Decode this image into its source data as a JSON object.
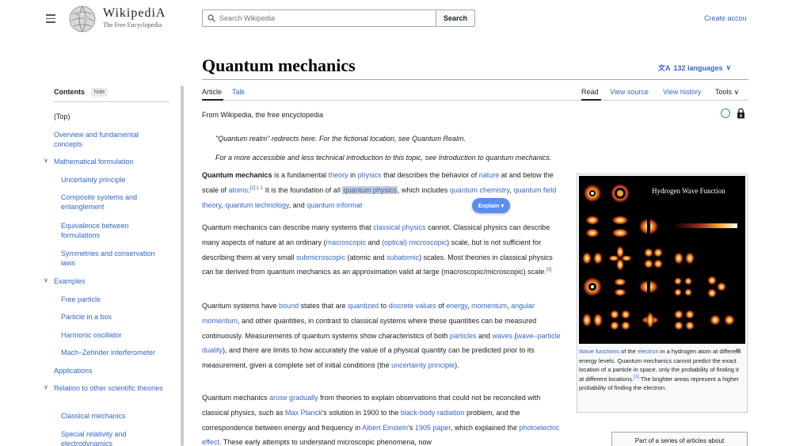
{
  "header": {
    "logo_word": "WikipediA",
    "logo_tagline": "The Free Encyclopedia",
    "search_placeholder": "Search Wikipedia",
    "search_button": "Search",
    "create_account": "Create accou"
  },
  "toc": {
    "title": "Contents",
    "hide": "hide",
    "items": [
      {
        "label": "(Top)",
        "level": 1,
        "expandable": false,
        "current": true
      },
      {
        "label": "Overview and fundamental concepts",
        "level": 1,
        "expandable": false
      },
      {
        "label": "Mathematical formulation",
        "level": 1,
        "expandable": true
      },
      {
        "label": "Uncertainty principle",
        "level": 2
      },
      {
        "label": "Composite systems and entanglement",
        "level": 2
      },
      {
        "label": "Equivalence between formulations",
        "level": 2
      },
      {
        "label": "Symmetries and conservation laws",
        "level": 2
      },
      {
        "label": "Examples",
        "level": 1,
        "expandable": true
      },
      {
        "label": "Free particle",
        "level": 2
      },
      {
        "label": "Particle in a box",
        "level": 2
      },
      {
        "label": "Harmonic oscillator",
        "level": 2
      },
      {
        "label": "Mach–Zehnder interferometer",
        "level": 2
      },
      {
        "label": "Applications",
        "level": 1,
        "expandable": false
      },
      {
        "label": "Relation to other scientific theories",
        "level": 1,
        "expandable": true
      },
      {
        "label": "Classical mechanics",
        "level": 2
      },
      {
        "label": "Special relativity and electrodynamics",
        "level": 2
      }
    ]
  },
  "article": {
    "title": "Quantum mechanics",
    "languages": "132 languages",
    "tabs": {
      "article": "Article",
      "talk": "Talk",
      "read": "Read",
      "view_source": "View source",
      "view_history": "View history",
      "tools": "Tools"
    },
    "from": "From Wikipedia, the free encyclopedia",
    "hatnote1": "\"Quantum realm\" redirects here. For the fictional location, see Quantum Realm.",
    "hatnote2": "For a more accessible and less technical introduction to this topic, see Introduction to quantum mechanics.",
    "explain_button": "Explain ▾"
  },
  "figure": {
    "title": "Hydrogen Wave Function",
    "caption": "Wave functions of the electron in a hydrogen atom at different energy levels. Quantum mechanics cannot predict the exact location of a particle in space, only the probability of finding it at different locations.[1] The brighter areas represent a higher probability of finding the electron."
  },
  "series_box": "Part of a series of articles about",
  "colors": {
    "link": "#3366cc",
    "text": "#202122",
    "border": "#a2a9b1",
    "explain": "#5b8def"
  }
}
